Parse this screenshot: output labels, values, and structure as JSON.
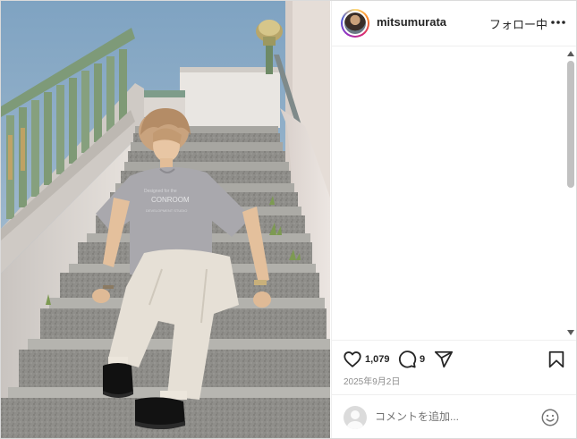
{
  "post": {
    "username": "mitsumurata",
    "follow_status": "フォロー中",
    "likes": "1,079",
    "comments_count": "9",
    "date": "2025年9月2日",
    "comment_placeholder": "コメントを追加..."
  },
  "icons": {
    "more": "more-horizontal-icon",
    "like": "heart-icon",
    "comment": "comment-bubble-icon",
    "share": "paper-plane-icon",
    "save": "bookmark-icon",
    "emoji": "smiley-icon"
  },
  "colors": {
    "text": "#262626",
    "muted": "#8e8e8e",
    "border": "#dbdbdb",
    "sky": "#8fb0c8",
    "stone": "#9a9a94",
    "railing": "#6f8d74",
    "shirt": "#a9a8ad",
    "pants": "#e6e0d6"
  }
}
